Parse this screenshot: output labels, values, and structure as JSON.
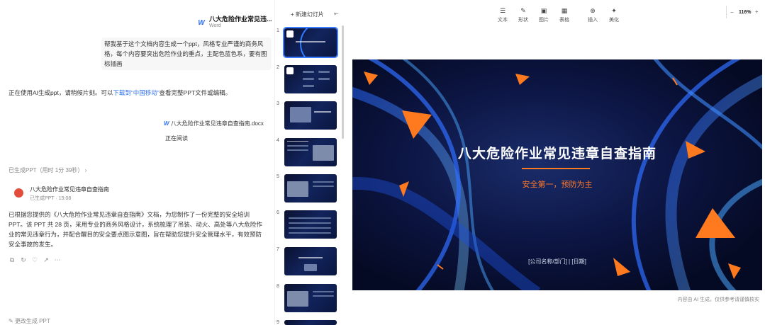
{
  "doc_card": {
    "title": "八大危险作业常见违...",
    "subtitle": "Word"
  },
  "user_message": "帮我基于这个文档内容生成一个ppt，风格专业严谨的商务风格，每个内容要突出危险作业的重点，主配色蓝色系，要有图标插画",
  "assistant_intro": {
    "before": "正在使用AI生成ppt，请稍候片刻。可以",
    "link": "下载到“中国移动”",
    "after": "查看完整PPT文件或编辑。"
  },
  "file_ref": {
    "label": "八大危险作业常见违章自查指南.docx"
  },
  "reading_label": "正在阅读",
  "ppt_status": "已生成PPT（用时 1分 39秒）",
  "ppt_result": {
    "title": "八大危险作业常见违章自查指南",
    "meta": "已生成PPT  ·  15:08"
  },
  "summary": "已根据您提供的《八大危险作业常见违章自查指南》文档，为您制作了一份完整的安全培训 PPT。该 PPT 共 28 页，采用专业的商务风格设计，系统梳理了吊装、动火、高处等八大危险作业的常见违章行为，并配合醒目的安全要点图示意图，旨在帮助您提升安全管理水平，有效预防安全事故的发生。",
  "bottom_link": "更改生成 PPT",
  "slides_panel": {
    "new_slide_label": "+ 新建幻灯片",
    "numbers": [
      "1",
      "2",
      "3",
      "4",
      "5",
      "6",
      "7",
      "8",
      "9"
    ]
  },
  "toolbar": {
    "items": [
      {
        "icon": "☰",
        "label": "文本"
      },
      {
        "icon": "✎",
        "label": "形状"
      },
      {
        "icon": "▣",
        "label": "图片"
      },
      {
        "icon": "▦",
        "label": "表格"
      },
      {
        "icon": "⊕",
        "label": "插入"
      },
      {
        "icon": "✦",
        "label": "美化"
      }
    ],
    "zoom_minus": "−",
    "zoom": "116%",
    "zoom_plus": "+"
  },
  "slide": {
    "title": "八大危险作业常见违章自查指南",
    "subtitle": "安全第一，预防为主",
    "footer": "[公司名称/部门] | [日期]"
  },
  "disclaimer": "内容由 AI 生成，仅供参考请谨慎核实",
  "colors": {
    "accent": "#2b6ef0",
    "orange": "#ff7a1f",
    "slide_bg": "#0c1542"
  }
}
